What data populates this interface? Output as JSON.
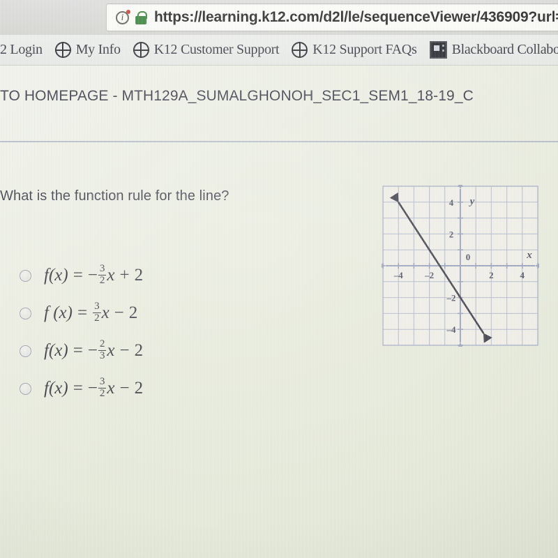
{
  "browser": {
    "url": "https://learning.k12.com/d2l/le/sequenceViewer/436909?url=",
    "info_icon": "info-circle-icon",
    "lock_icon": "padlock-secure-icon",
    "bookmarks": [
      {
        "label": "2 Login",
        "icon": "none"
      },
      {
        "label": "My Info",
        "icon": "globe-icon"
      },
      {
        "label": "K12 Customer Support",
        "icon": "globe-icon"
      },
      {
        "label": "K12 Support FAQs",
        "icon": "globe-icon"
      },
      {
        "label": "Blackboard Collaborat",
        "icon": "blackboard-icon"
      }
    ]
  },
  "page": {
    "course_header": "TO HOMEPAGE - MTH129A_SUMALGHONOH_SEC1_SEM1_18-19_C",
    "question": "What is the function rule for the line?",
    "options": [
      {
        "id": "option-a",
        "selected": false,
        "lhs": "f(x)",
        "eq": "=",
        "sign": "−",
        "num": "3",
        "den": "2",
        "var": "x",
        "op": "+",
        "const": "2",
        "text": "f(x) = -3/2 x + 2"
      },
      {
        "id": "option-b",
        "selected": false,
        "lhs": "f (x)",
        "eq": "=",
        "sign": "",
        "num": "3",
        "den": "2",
        "var": "x",
        "op": "−",
        "const": "2",
        "text": "f(x) = 3/2 x - 2"
      },
      {
        "id": "option-c",
        "selected": false,
        "lhs": "f(x)",
        "eq": "=",
        "sign": "−",
        "num": "2",
        "den": "3",
        "var": "x",
        "op": "−",
        "const": "2",
        "text": "f(x) = -2/3 x - 2"
      },
      {
        "id": "option-d",
        "selected": false,
        "lhs": "f(x)",
        "eq": "=",
        "sign": "−",
        "num": "3",
        "den": "2",
        "var": "x",
        "op": "−",
        "const": "2",
        "text": "f(x) = -3/2 x - 2"
      }
    ]
  },
  "chart_data": {
    "type": "line",
    "title": "",
    "xlabel": "x",
    "ylabel": "y",
    "origin_label": "0",
    "xlim": [
      -5,
      5
    ],
    "ylim": [
      -5,
      5
    ],
    "xticks": [
      -4,
      -2,
      2,
      4
    ],
    "yticks": [
      4,
      2,
      -2,
      -4
    ],
    "xtick_labels": [
      "–4",
      "–2",
      "2",
      "4"
    ],
    "ytick_labels": [
      "4",
      "2",
      "–2",
      "–4"
    ],
    "grid": true,
    "grid_step": 1,
    "axis_arrows": "both",
    "series": [
      {
        "name": "line",
        "equation": "y = -3/2 x - 2",
        "slope": -1.5,
        "intercept": -2,
        "x": [
          -4.0,
          1.5
        ],
        "y": [
          4.0,
          -4.25
        ],
        "arrow_start": true,
        "arrow_end": true,
        "color": "#2a2a38"
      }
    ],
    "colors": {
      "grid": "#9fa8c4",
      "axis": "#8f98b6",
      "line": "#2a2a38",
      "text": "#3a3f57",
      "plot_bg": "#efeee6"
    }
  }
}
